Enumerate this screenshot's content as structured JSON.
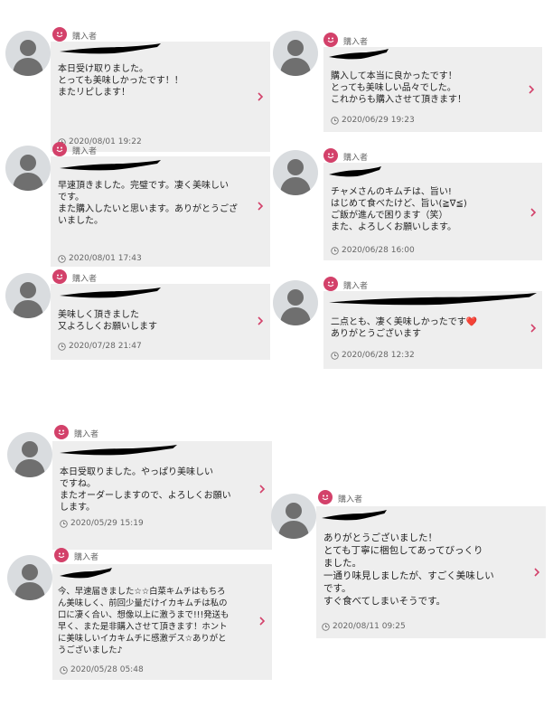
{
  "reviews": [
    {
      "role": "購入者",
      "text": "本日受け取りました。\nとっても美味しかったです！！\nまたリピします！",
      "date": "2020/08/01 19:22"
    },
    {
      "role": "購入者",
      "text": "早速頂きました。完璧です。凄く美味しい\nです。\nまた購入したいと思います。ありがとうござ\nいました。",
      "date": "2020/08/01 17:43"
    },
    {
      "role": "購入者",
      "text": "美味しく頂きました\n又よろしくお願いします",
      "date": "2020/07/28 21:47"
    },
    {
      "role": "購入者",
      "text": "購入して本当に良かったです！\nとっても美味しい品々でした。\nこれからも購入させて頂きます！",
      "date": "2020/06/29 19:23"
    },
    {
      "role": "購入者",
      "text": "チャメさんのキムチは、旨い!\nはじめて食べたけど、旨い(≧∇≦)\nご飯が進んで困ります（笑）\nまた、よろしくお願いします。",
      "date": "2020/06/28 16:00"
    },
    {
      "role": "購入者",
      "text": "二点とも、凄く美味しかったです❤️\nありがとうございます",
      "date": "2020/06/28 12:32"
    },
    {
      "role": "購入者",
      "text": "本日受取りました。やっぱり美味しい\nですね。\nまたオーダーしますので、よろしくお願い\nします。",
      "date": "2020/05/29 15:19"
    },
    {
      "role": "購入者",
      "text": "今、早速届きました☆☆白菜キムチはもちろ\nん美味しく、前回少量だけイカキムチは私の\n口に凄く合い、想像以上に激うまで!!!発送も\n早く、また是非購入させて頂きます！ホント\nに美味しいイカキムチに感激デス☆ありがと\nうございました♪",
      "date": "2020/05/28 05:48"
    },
    {
      "role": "購入者",
      "text": "ありがとうございました！\nとても丁寧に梱包してあってびっくり\nました。\n一通り味見しましたが、すごく美味しい\nです。\nすぐ食べてしまいそうです。",
      "date": "2020/08/11 09:25"
    }
  ],
  "icons": {
    "avatar": "person-silhouette-icon",
    "badge": "smiley-face-icon",
    "date": "clock-icon",
    "chevron": "chevron-right-icon"
  },
  "colors": {
    "badge": "#d3416a",
    "chevron": "#d3416a",
    "card": "#eeeeee"
  }
}
